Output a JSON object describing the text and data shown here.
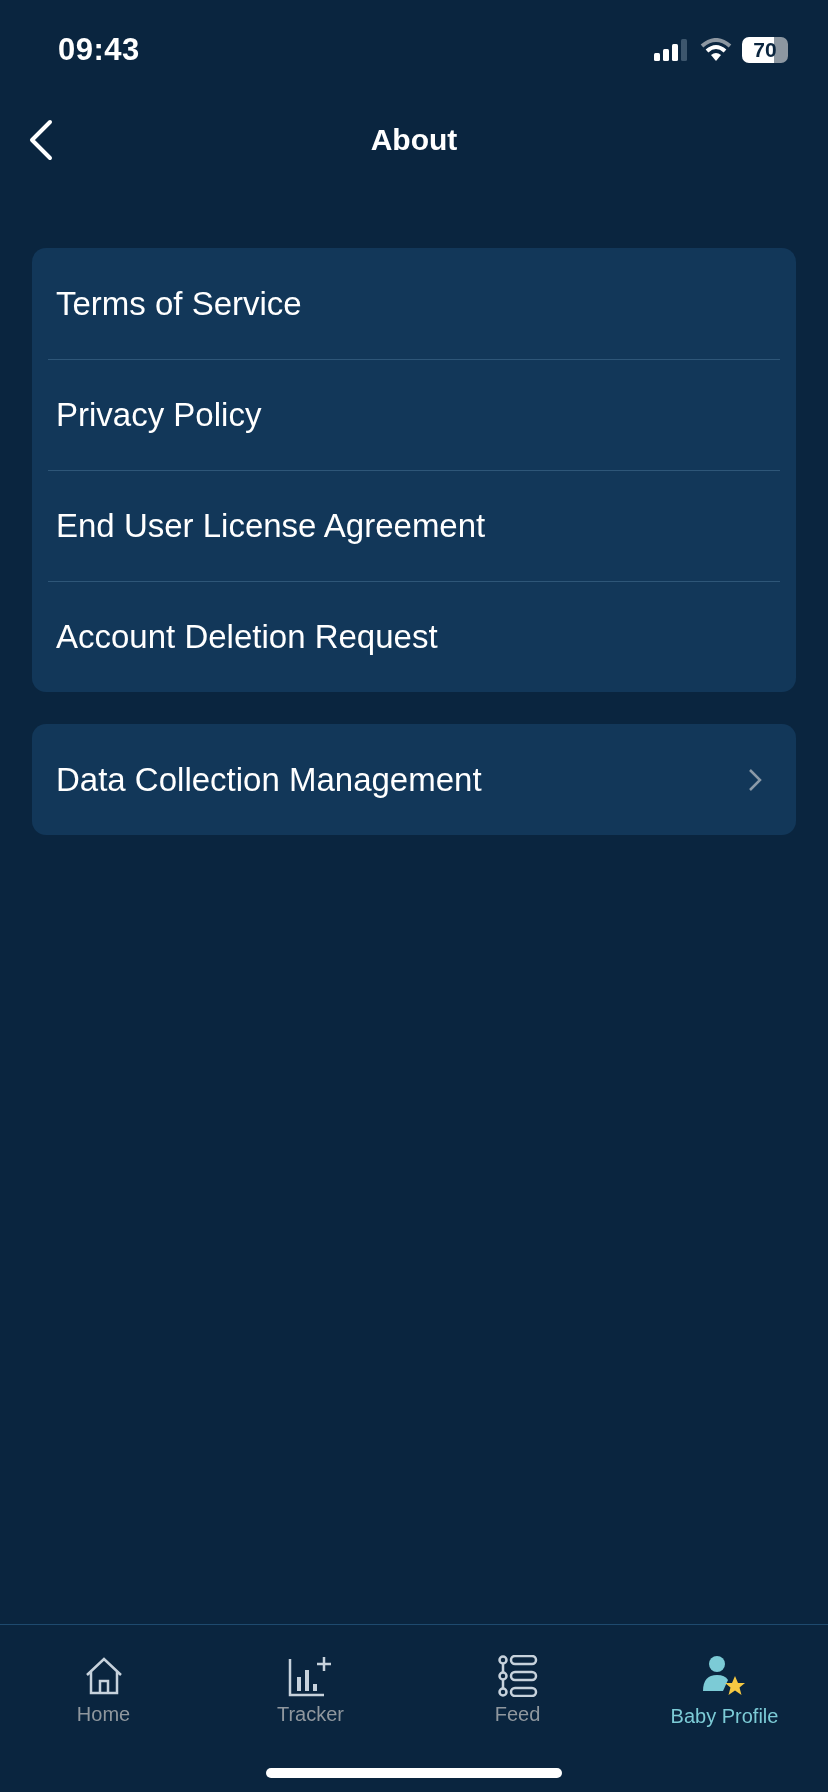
{
  "status_bar": {
    "time": "09:43",
    "battery": "70"
  },
  "nav": {
    "title": "About"
  },
  "groups": [
    {
      "items": [
        {
          "label": "Terms of Service",
          "kind": "plain"
        },
        {
          "label": "Privacy Policy",
          "kind": "plain"
        },
        {
          "label": "End User License Agreement",
          "kind": "plain"
        },
        {
          "label": "Account Deletion Request",
          "kind": "plain"
        }
      ]
    },
    {
      "items": [
        {
          "label": "Data Collection Management",
          "kind": "chevron"
        }
      ]
    }
  ],
  "tab_bar": [
    {
      "label": "Home",
      "kind": "home",
      "selected": false
    },
    {
      "label": "Tracker",
      "kind": "tracker",
      "selected": false
    },
    {
      "label": "Feed",
      "kind": "feed",
      "selected": false
    },
    {
      "label": "Baby Profile",
      "kind": "profile",
      "selected": true
    }
  ]
}
